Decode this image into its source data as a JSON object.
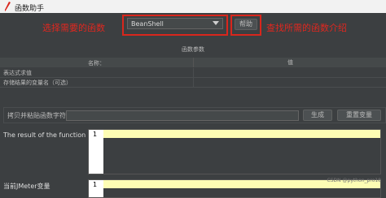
{
  "window": {
    "title": "函数助手"
  },
  "annotations": {
    "left": "选择需要的函数",
    "right": "查找所需的函数介绍"
  },
  "function_select": {
    "selected": "BeanShell"
  },
  "buttons": {
    "help": "帮助",
    "generate": "生成",
    "reset": "重置变量"
  },
  "params": {
    "section_title": "函数参数",
    "columns": [
      "名称：",
      "值"
    ],
    "rows": [
      "表达式求值",
      "存储结果的变量名（可选）"
    ]
  },
  "paste": {
    "label": "拷贝并粘贴函数字符串",
    "value": ""
  },
  "result": {
    "label": "The result of the function is",
    "line_number": "1"
  },
  "jmeter": {
    "label": "当前JMeter变量",
    "line_number": "1"
  },
  "watermark": "CSDN @python_pro18",
  "colors": {
    "annotation_red": "#e0271f",
    "editor_highlight": "#fdfdb4"
  }
}
